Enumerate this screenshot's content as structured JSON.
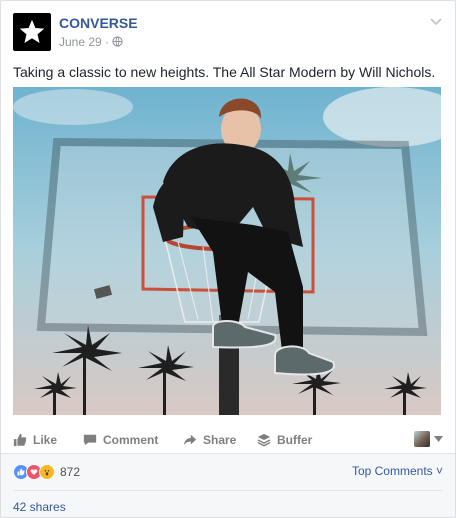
{
  "post": {
    "page_name": "CONVERSE",
    "date": "June 29",
    "separator": "·",
    "text": "Taking a classic to new heights. The All Star Modern by Will Nichols."
  },
  "actions": {
    "like": "Like",
    "comment": "Comment",
    "share": "Share",
    "buffer": "Buffer"
  },
  "footer": {
    "reaction_count": "872",
    "top_comments": "Top Comments ˅",
    "shares": "42 shares"
  },
  "colors": {
    "brand": "#365899",
    "like_blue": "#5890ff",
    "love_red": "#f25268",
    "wow_yellow": "#f7b928"
  },
  "icons": [
    "converse-star-logo-icon",
    "globe-icon",
    "chevron-down-icon",
    "like-icon",
    "comment-icon",
    "share-icon",
    "buffer-icon",
    "audience-avatar-icon",
    "caret-down-icon",
    "like-reaction-icon",
    "love-reaction-icon",
    "wow-reaction-icon"
  ]
}
